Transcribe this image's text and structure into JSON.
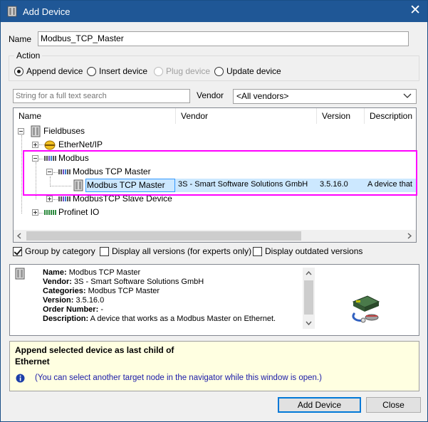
{
  "window": {
    "title": "Add Device",
    "close_glyph": "✕"
  },
  "name_field": {
    "label": "Name",
    "value": "Modbus_TCP_Master"
  },
  "action": {
    "group_label": "Action",
    "options": [
      {
        "label": "Append device",
        "checked": true,
        "enabled": true
      },
      {
        "label": "Insert device",
        "checked": false,
        "enabled": true
      },
      {
        "label": "Plug device",
        "checked": false,
        "enabled": false
      },
      {
        "label": "Update device",
        "checked": false,
        "enabled": true
      }
    ]
  },
  "search": {
    "placeholder": "String for a full text search",
    "vendor_label": "Vendor",
    "vendor_selected": "<All vendors>"
  },
  "device_list": {
    "columns": [
      "Name",
      "Vendor",
      "Version",
      "Description"
    ],
    "rows": [
      {
        "label": "Fieldbuses",
        "icon": "fieldbus-icon"
      },
      {
        "label": "EtherNet/IP",
        "icon": "ethernet-ip-icon"
      },
      {
        "label": "Modbus",
        "icon": "modbus-icon"
      },
      {
        "label": "Modbus TCP Master",
        "icon": "modbus-icon"
      },
      {
        "label": "Modbus TCP Master",
        "icon": "device-icon",
        "vendor": "3S - Smart Software Solutions GmbH",
        "version": "3.5.16.0",
        "description": "A device that"
      },
      {
        "label": "ModbusTCP Slave Device",
        "icon": "modbus-icon"
      },
      {
        "label": "Profinet IO",
        "icon": "profinet-icon"
      }
    ]
  },
  "options": {
    "group_by_category": {
      "label": "Group by category",
      "checked": true
    },
    "display_all_versions": {
      "label": "Display all versions (for experts only)",
      "checked": false
    },
    "display_outdated": {
      "label": "Display outdated versions",
      "checked": false
    }
  },
  "details": {
    "name_label": "Name:",
    "name_value": "Modbus TCP Master",
    "vendor_label": "Vendor:",
    "vendor_value": "3S - Smart Software Solutions GmbH",
    "categories_label": "Categories:",
    "categories_value": "Modbus TCP Master",
    "version_label": "Version:",
    "version_value": "3.5.16.0",
    "order_label": "Order Number:",
    "order_value": "-",
    "description_label": "Description:",
    "description_value": "A device that works as a Modbus Master on Ethernet."
  },
  "hint": {
    "title_line1": "Append selected device as last child of",
    "title_line2": "Ethernet",
    "info_text": "(You can select another target node in the navigator while this window is open.)"
  },
  "buttons": {
    "add_device": "Add Device",
    "close": "Close"
  },
  "colors": {
    "titlebar": "#1f5796",
    "selection": "#cce8ff",
    "highlight_frame": "#ff00ff",
    "hint_background": "#ffffe1",
    "info_text": "#1a1aa8"
  }
}
